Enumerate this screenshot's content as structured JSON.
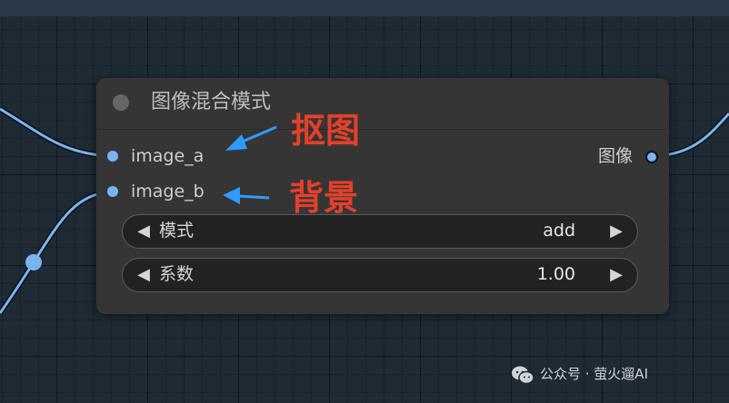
{
  "node": {
    "title": "图像混合模式",
    "inputs": [
      {
        "label": "image_a"
      },
      {
        "label": "image_b"
      }
    ],
    "output": {
      "label": "图像"
    },
    "widgets": [
      {
        "label": "模式",
        "value": "add"
      },
      {
        "label": "系数",
        "value": "1.00"
      }
    ]
  },
  "annotations": {
    "image_a_note": "抠图",
    "image_b_note": "背景"
  },
  "watermark": {
    "text": "公众号 · 萤火遛AI"
  },
  "colors": {
    "canvas_background": "#1f2a35",
    "node_background": "#353535",
    "wire": "#7ab4f0",
    "annotation_text": "#e4402a",
    "annotation_arrow": "#2f9bff"
  },
  "icons": {
    "widget_prev": "◀",
    "widget_next": "▶"
  }
}
